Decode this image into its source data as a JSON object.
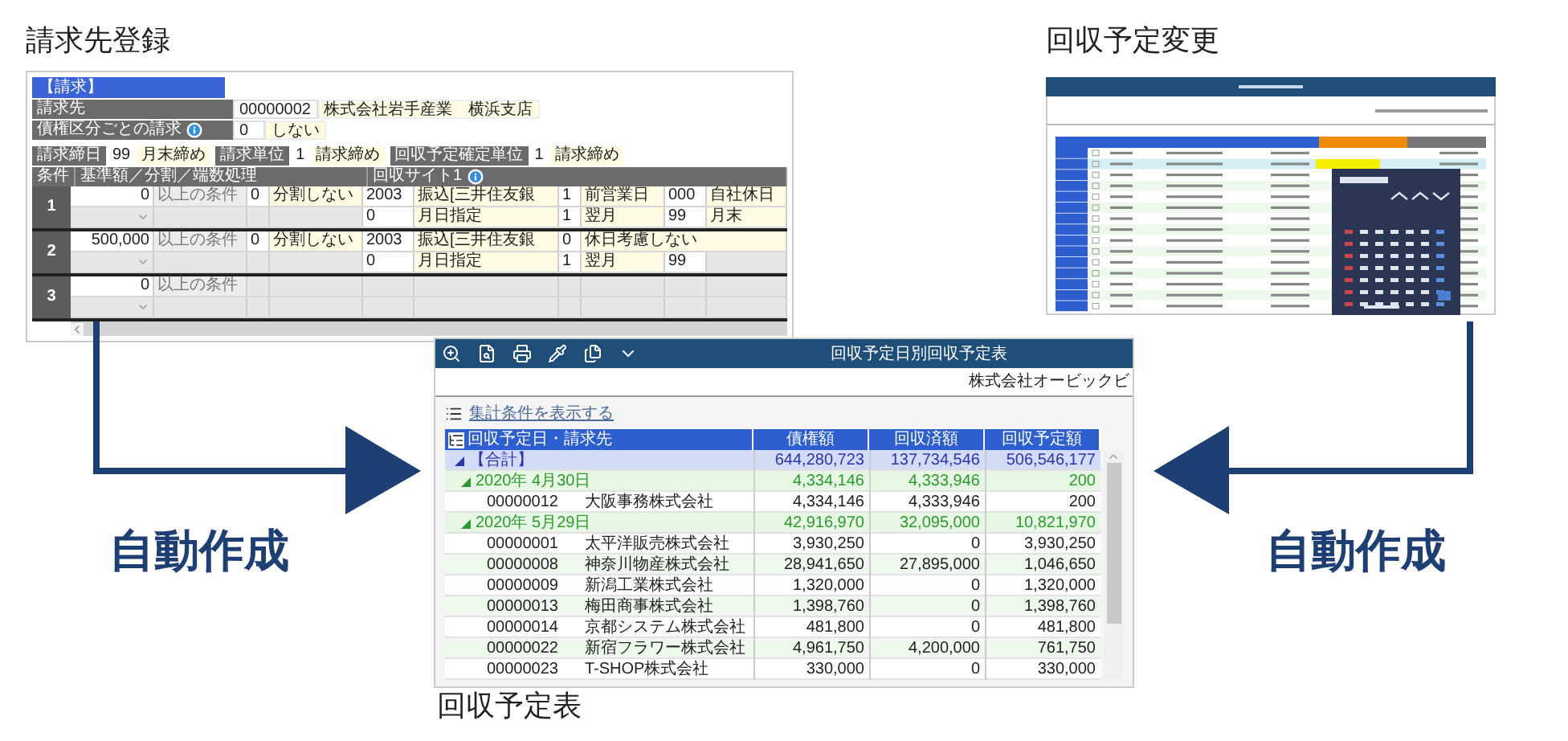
{
  "billing_registration": {
    "title": "請求先登録",
    "section": "【請求】",
    "fields": [
      {
        "label": "請求先",
        "code": "00000002",
        "value": "株式会社岩手産業　横浜支店",
        "info": false
      },
      {
        "label": "債権区分ごとの請求",
        "code": "0",
        "value": "しない",
        "info": true
      }
    ],
    "closing": [
      {
        "label": "請求締日",
        "code": "99",
        "value": "月末締め"
      },
      {
        "label": "請求単位",
        "code": "1",
        "value": "請求締め"
      },
      {
        "label": "回収予定確定単位",
        "code": "1",
        "value": "請求締め"
      }
    ],
    "columns": [
      {
        "label": "条件",
        "info": false
      },
      {
        "label": "基準額／分割／端数処理",
        "info": false
      },
      {
        "label": "回収サイト1",
        "info": true
      }
    ],
    "conditions": [
      {
        "number": "1",
        "lines": [
          [
            {
              "kind": "amount",
              "text": "0"
            },
            {
              "kind": "label",
              "text": "以上の条件"
            },
            {
              "kind": "code",
              "text": "0"
            },
            {
              "kind": "value",
              "text": "分割しない"
            },
            {
              "kind": "code",
              "text": "2003"
            },
            {
              "kind": "value",
              "text": "振込[三井住友銀"
            },
            {
              "kind": "code",
              "text": "1"
            },
            {
              "kind": "value",
              "text": "前営業日"
            },
            {
              "kind": "code",
              "text": "000"
            },
            {
              "kind": "value",
              "text": "自社休日"
            }
          ],
          [
            {
              "kind": "dropdown"
            },
            {
              "kind": "blank"
            },
            {
              "kind": "blank"
            },
            {
              "kind": "blank"
            },
            {
              "kind": "code",
              "text": "0"
            },
            {
              "kind": "value",
              "text": "月日指定"
            },
            {
              "kind": "code",
              "text": "1"
            },
            {
              "kind": "value",
              "text": "翌月"
            },
            {
              "kind": "code",
              "text": "99"
            },
            {
              "kind": "value",
              "text": "月末"
            }
          ]
        ]
      },
      {
        "number": "2",
        "lines": [
          [
            {
              "kind": "amount",
              "text": "500,000"
            },
            {
              "kind": "label",
              "text": "以上の条件"
            },
            {
              "kind": "code",
              "text": "0"
            },
            {
              "kind": "value",
              "text": "分割しない"
            },
            {
              "kind": "code",
              "text": "2003"
            },
            {
              "kind": "value",
              "text": "振込[三井住友銀"
            },
            {
              "kind": "code",
              "text": "0"
            },
            {
              "kind": "value",
              "text": "休日考慮しない"
            }
          ],
          [
            {
              "kind": "dropdown"
            },
            {
              "kind": "blank"
            },
            {
              "kind": "blank"
            },
            {
              "kind": "blank"
            },
            {
              "kind": "code",
              "text": "0"
            },
            {
              "kind": "value",
              "text": "月日指定"
            },
            {
              "kind": "code",
              "text": "1"
            },
            {
              "kind": "value",
              "text": "翌月"
            },
            {
              "kind": "code",
              "text": "99"
            },
            {
              "kind": "blank"
            }
          ]
        ]
      },
      {
        "number": "3",
        "lines": [
          [
            {
              "kind": "amount",
              "text": "0"
            },
            {
              "kind": "label",
              "text": "以上の条件"
            },
            {
              "kind": "blank"
            },
            {
              "kind": "blank"
            },
            {
              "kind": "blank"
            },
            {
              "kind": "blank"
            },
            {
              "kind": "blank"
            },
            {
              "kind": "blank"
            },
            {
              "kind": "blank"
            },
            {
              "kind": "blank"
            }
          ],
          [
            {
              "kind": "dropdown"
            },
            {
              "kind": "blank"
            },
            {
              "kind": "blank"
            },
            {
              "kind": "blank"
            },
            {
              "kind": "blank"
            },
            {
              "kind": "blank"
            },
            {
              "kind": "blank"
            },
            {
              "kind": "blank"
            },
            {
              "kind": "blank"
            },
            {
              "kind": "blank"
            }
          ]
        ]
      }
    ]
  },
  "schedule_change": {
    "title": "回収予定変更"
  },
  "schedule_report": {
    "title": "回収予定表",
    "window_title": "回収予定日別回収予定表",
    "company": "株式会社オービックビ",
    "link": "集計条件を表示する",
    "columns": [
      "回収予定日・請求先",
      "債権額",
      "回収済額",
      "回収予定額"
    ],
    "rows": [
      {
        "label": "【合計】",
        "expanded": true,
        "values": [
          "644,280,723",
          "137,734,546",
          "506,546,177"
        ],
        "children": [
          {
            "label": "2020年 4月30日",
            "expanded": true,
            "values": [
              "4,334,146",
              "4,333,946",
              "200"
            ],
            "children": [
              {
                "code": "00000012",
                "name": "大阪事務株式会社",
                "values": [
                  "4,334,146",
                  "4,333,946",
                  "200"
                ]
              }
            ]
          },
          {
            "label": "2020年 5月29日",
            "expanded": true,
            "values": [
              "42,916,970",
              "32,095,000",
              "10,821,970"
            ],
            "children": [
              {
                "code": "00000001",
                "name": "太平洋販売株式会社",
                "values": [
                  "3,930,250",
                  "0",
                  "3,930,250"
                ]
              },
              {
                "code": "00000008",
                "name": "神奈川物産株式会社",
                "values": [
                  "28,941,650",
                  "27,895,000",
                  "1,046,650"
                ]
              },
              {
                "code": "00000009",
                "name": "新潟工業株式会社",
                "values": [
                  "1,320,000",
                  "0",
                  "1,320,000"
                ]
              },
              {
                "code": "00000013",
                "name": "梅田商事株式会社",
                "values": [
                  "1,398,760",
                  "0",
                  "1,398,760"
                ]
              },
              {
                "code": "00000014",
                "name": "京都システム株式会社",
                "values": [
                  "481,800",
                  "0",
                  "481,800"
                ]
              },
              {
                "code": "00000022",
                "name": "新宿フラワー株式会社",
                "values": [
                  "4,961,750",
                  "4,200,000",
                  "761,750"
                ]
              },
              {
                "code": "00000023",
                "name": "T-SHOP株式会社",
                "values": [
                  "330,000",
                  "0",
                  "330,000"
                ]
              }
            ]
          }
        ]
      }
    ]
  },
  "arrows": [
    {
      "label": "自動作成"
    },
    {
      "label": "自動作成"
    }
  ]
}
